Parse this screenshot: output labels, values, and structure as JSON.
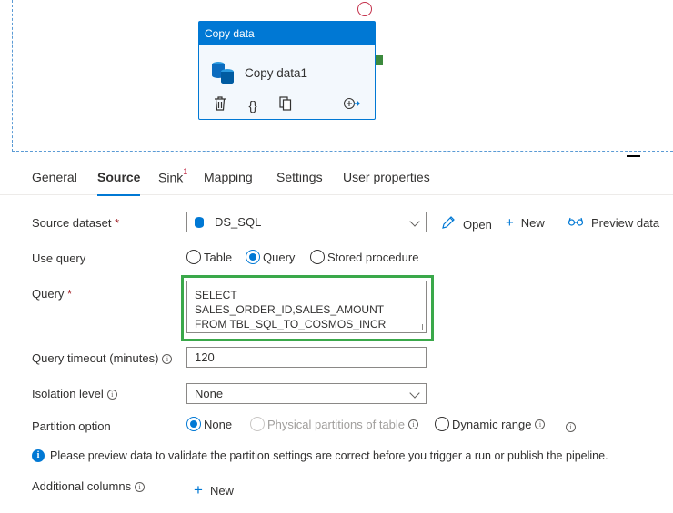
{
  "activity": {
    "header": "Copy data",
    "name": "Copy data1"
  },
  "tabs": [
    {
      "label": "General"
    },
    {
      "label": "Source"
    },
    {
      "label": "Sink",
      "badge": "1"
    },
    {
      "label": "Mapping"
    },
    {
      "label": "Settings"
    },
    {
      "label": "User properties"
    }
  ],
  "source_dataset": {
    "label": "Source dataset",
    "required": "*",
    "value": "DS_SQL",
    "open": "Open",
    "new": "New",
    "preview": "Preview data"
  },
  "use_query": {
    "label": "Use query",
    "options": [
      "Table",
      "Query",
      "Stored procedure"
    ],
    "selected": "Query"
  },
  "query": {
    "label": "Query",
    "required": "*",
    "value": "SELECT SALES_ORDER_ID,SALES_AMOUNT\nFROM TBL_SQL_TO_COSMOS_INCR"
  },
  "timeout": {
    "label": "Query timeout (minutes)",
    "value": "120"
  },
  "isolation": {
    "label": "Isolation level",
    "value": "None"
  },
  "partition": {
    "label": "Partition option",
    "options": [
      "None",
      "Physical partitions of table",
      "Dynamic range"
    ],
    "selected": "None"
  },
  "notice": "Please preview data to validate the partition settings are correct before you trigger a run or publish the pipeline.",
  "additional_columns": {
    "label": "Additional columns",
    "new": "New"
  },
  "colors": {
    "accent": "#0078d4",
    "highlight": "#3aa84a"
  }
}
